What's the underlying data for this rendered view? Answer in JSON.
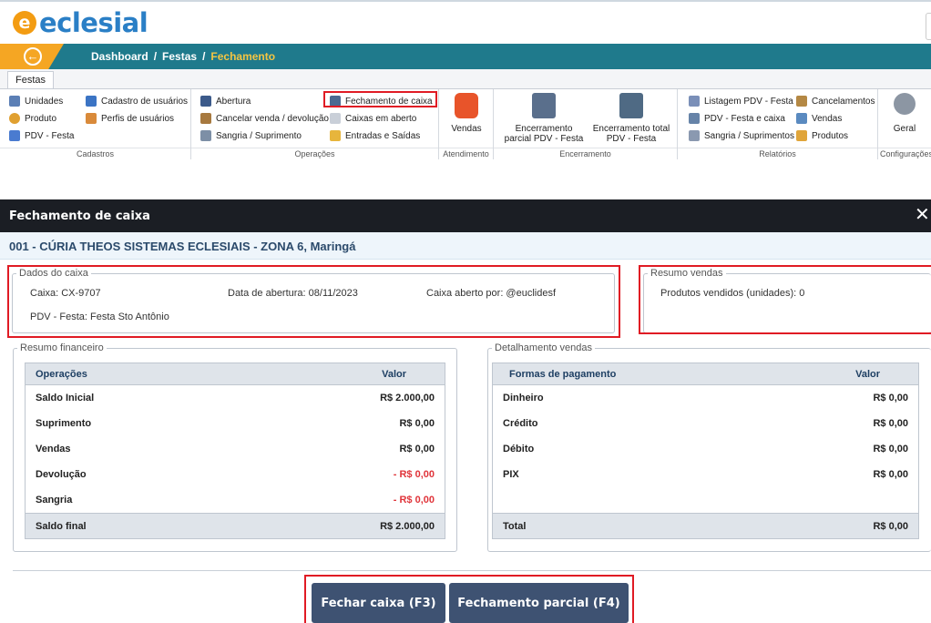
{
  "app": {
    "logo_mark": "e",
    "logo_text": "eclesial"
  },
  "nav": {
    "back_icon": "arrow-left-circle-icon",
    "breadcrumb": [
      "Dashboard",
      "Festas",
      "Fechamento"
    ]
  },
  "ribbon": {
    "tab": "Festas",
    "groups": {
      "cadastros": {
        "label": "Cadastros",
        "items": [
          "Unidades",
          "Cadastro de usuários",
          "Produto",
          "Perfis de usuários",
          "PDV - Festa"
        ]
      },
      "operacoes": {
        "label": "Operações",
        "items": [
          "Abertura",
          "Fechamento de caixa",
          "Cancelar venda / devolução",
          "Caixas em aberto",
          "Sangria / Suprimento",
          "Entradas e Saídas"
        ]
      },
      "atendimento": {
        "label": "Atendimento",
        "items": [
          "Vendas"
        ]
      },
      "encerramento": {
        "label": "Encerramento",
        "items": [
          "Encerramento parcial PDV - Festa",
          "Encerramento total PDV - Festa"
        ]
      },
      "relatorios": {
        "label": "Relatórios",
        "items": [
          "Listagem PDV - Festa",
          "Cancelamentos",
          "PDV - Festa e caixa",
          "Vendas",
          "Sangria / Suprimentos",
          "Produtos"
        ]
      },
      "configuracoes": {
        "label": "Configurações",
        "items": [
          "Geral"
        ]
      }
    }
  },
  "modal": {
    "title": "Fechamento de caixa",
    "close_icon": "close-icon",
    "org": "001 - CÚRIA THEOS SISTEMAS ECLESIAIS - ZONA 6, Maringá",
    "dados_caixa": {
      "legend": "Dados do caixa",
      "caixa": "Caixa: CX-9707",
      "data_abertura": "Data de abertura: 08/11/2023",
      "aberto_por": "Caixa aberto por: @euclidesf",
      "pdv": "PDV - Festa: Festa Sto Antônio"
    },
    "resumo_vendas": {
      "legend": "Resumo vendas",
      "produtos": "Produtos vendidos (unidades): 0"
    },
    "resumo_financeiro": {
      "legend": "Resumo financeiro",
      "headers": [
        "Operações",
        "Valor"
      ],
      "rows": [
        {
          "label": "Saldo Inicial",
          "value": "R$ 2.000,00"
        },
        {
          "label": "Suprimento",
          "value": "R$ 0,00"
        },
        {
          "label": "Vendas",
          "value": "R$ 0,00"
        },
        {
          "label": "Devolução",
          "value": "- R$ 0,00"
        },
        {
          "label": "Sangria",
          "value": "- R$ 0,00"
        }
      ],
      "footer": {
        "label": "Saldo final",
        "value": "R$ 2.000,00"
      }
    },
    "detalhamento_vendas": {
      "legend": "Detalhamento vendas",
      "headers": [
        "Formas de pagamento",
        "Valor"
      ],
      "rows": [
        {
          "label": "Dinheiro",
          "value": "R$ 0,00"
        },
        {
          "label": "Crédito",
          "value": "R$ 0,00"
        },
        {
          "label": "Débito",
          "value": "R$ 0,00"
        },
        {
          "label": "PIX",
          "value": "R$ 0,00"
        }
      ],
      "footer": {
        "label": "Total",
        "value": "R$ 0,00"
      }
    },
    "buttons": {
      "fechar": "Fechar caixa (F3)",
      "parcial": "Fechamento parcial (F4)"
    }
  },
  "colors": {
    "brand": "#2a7fc6",
    "nav": "#1f7a8c",
    "accent": "#f5a623",
    "highlight": "#e01b24",
    "negative": "#e0343a",
    "button": "#3e5272"
  }
}
